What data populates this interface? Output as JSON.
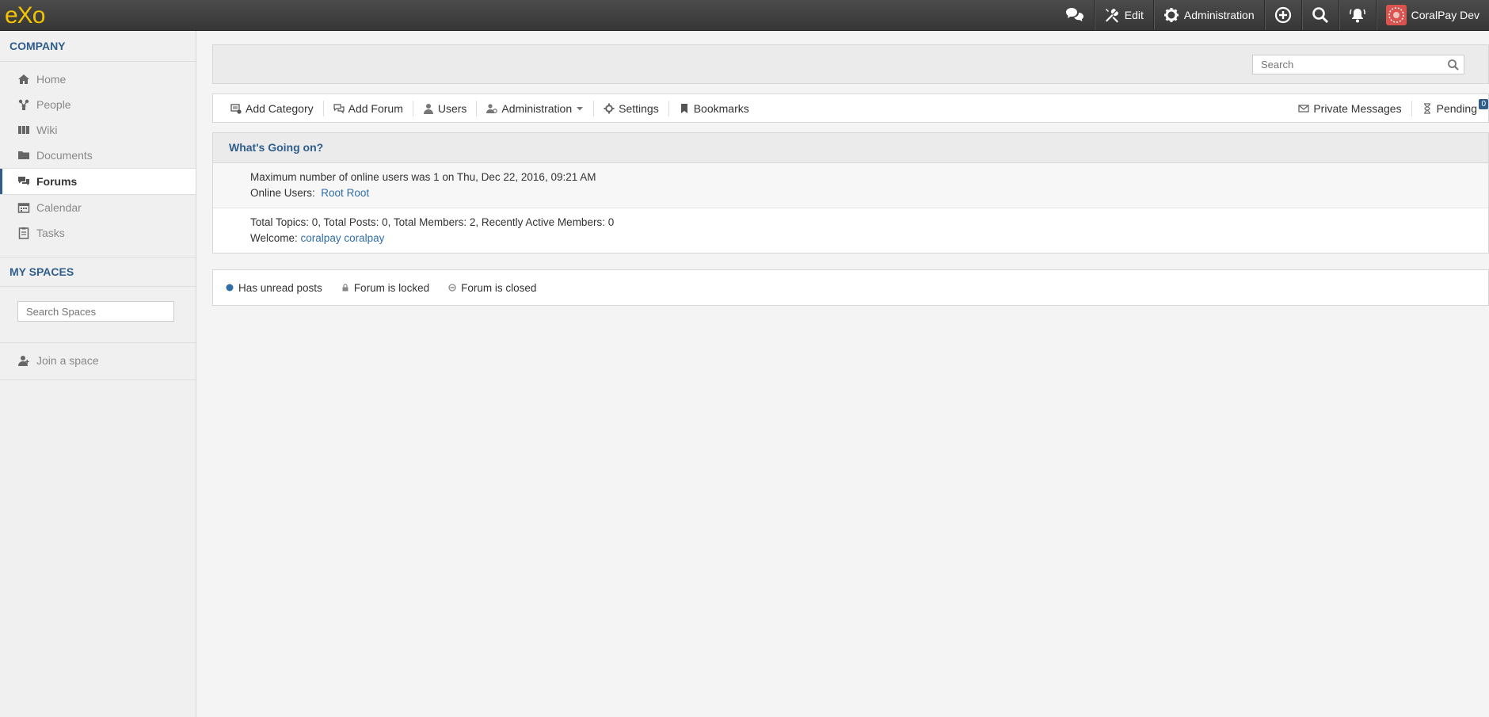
{
  "topbar": {
    "logo_text": "eXo",
    "edit_label": "Edit",
    "administration_label": "Administration",
    "user_name": "CoralPay Dev"
  },
  "sidebar": {
    "company_title": "COMPANY",
    "nav": [
      {
        "label": "Home",
        "icon": "home-icon"
      },
      {
        "label": "People",
        "icon": "people-icon"
      },
      {
        "label": "Wiki",
        "icon": "wiki-icon"
      },
      {
        "label": "Documents",
        "icon": "folder-icon"
      },
      {
        "label": "Forums",
        "icon": "forums-icon"
      },
      {
        "label": "Calendar",
        "icon": "calendar-icon"
      },
      {
        "label": "Tasks",
        "icon": "tasks-icon"
      }
    ],
    "active_item": "Forums",
    "spaces_title": "MY SPACES",
    "search_spaces_placeholder": "Search Spaces",
    "join_space_label": "Join a space"
  },
  "forum": {
    "search_placeholder": "Search",
    "toolbar": {
      "add_category": "Add Category",
      "add_forum": "Add Forum",
      "users": "Users",
      "administration": "Administration",
      "settings": "Settings",
      "bookmarks": "Bookmarks",
      "private_messages": "Private Messages",
      "pending": "Pending",
      "pending_count": "0"
    },
    "whats_going_on": {
      "title": "What's Going on?",
      "max_online_text": "Maximum number of online users was 1 on Thu, Dec 22, 2016, 09:21 AM",
      "online_users_label": "Online Users:",
      "online_user": "Root Root",
      "stats_text": "Total Topics: 0, Total Posts: 0, Total Members: 2, Recently Active Members: 0",
      "welcome_label": "Welcome:",
      "welcome_user": "coralpay coralpay"
    },
    "legend": {
      "unread": "Has unread posts",
      "locked": "Forum is locked",
      "closed": "Forum is closed"
    }
  },
  "colors": {
    "accent": "#2f5e8c",
    "link": "#2f6ea6",
    "topbar": "#3c3c3c",
    "logo": "#f5c400"
  }
}
